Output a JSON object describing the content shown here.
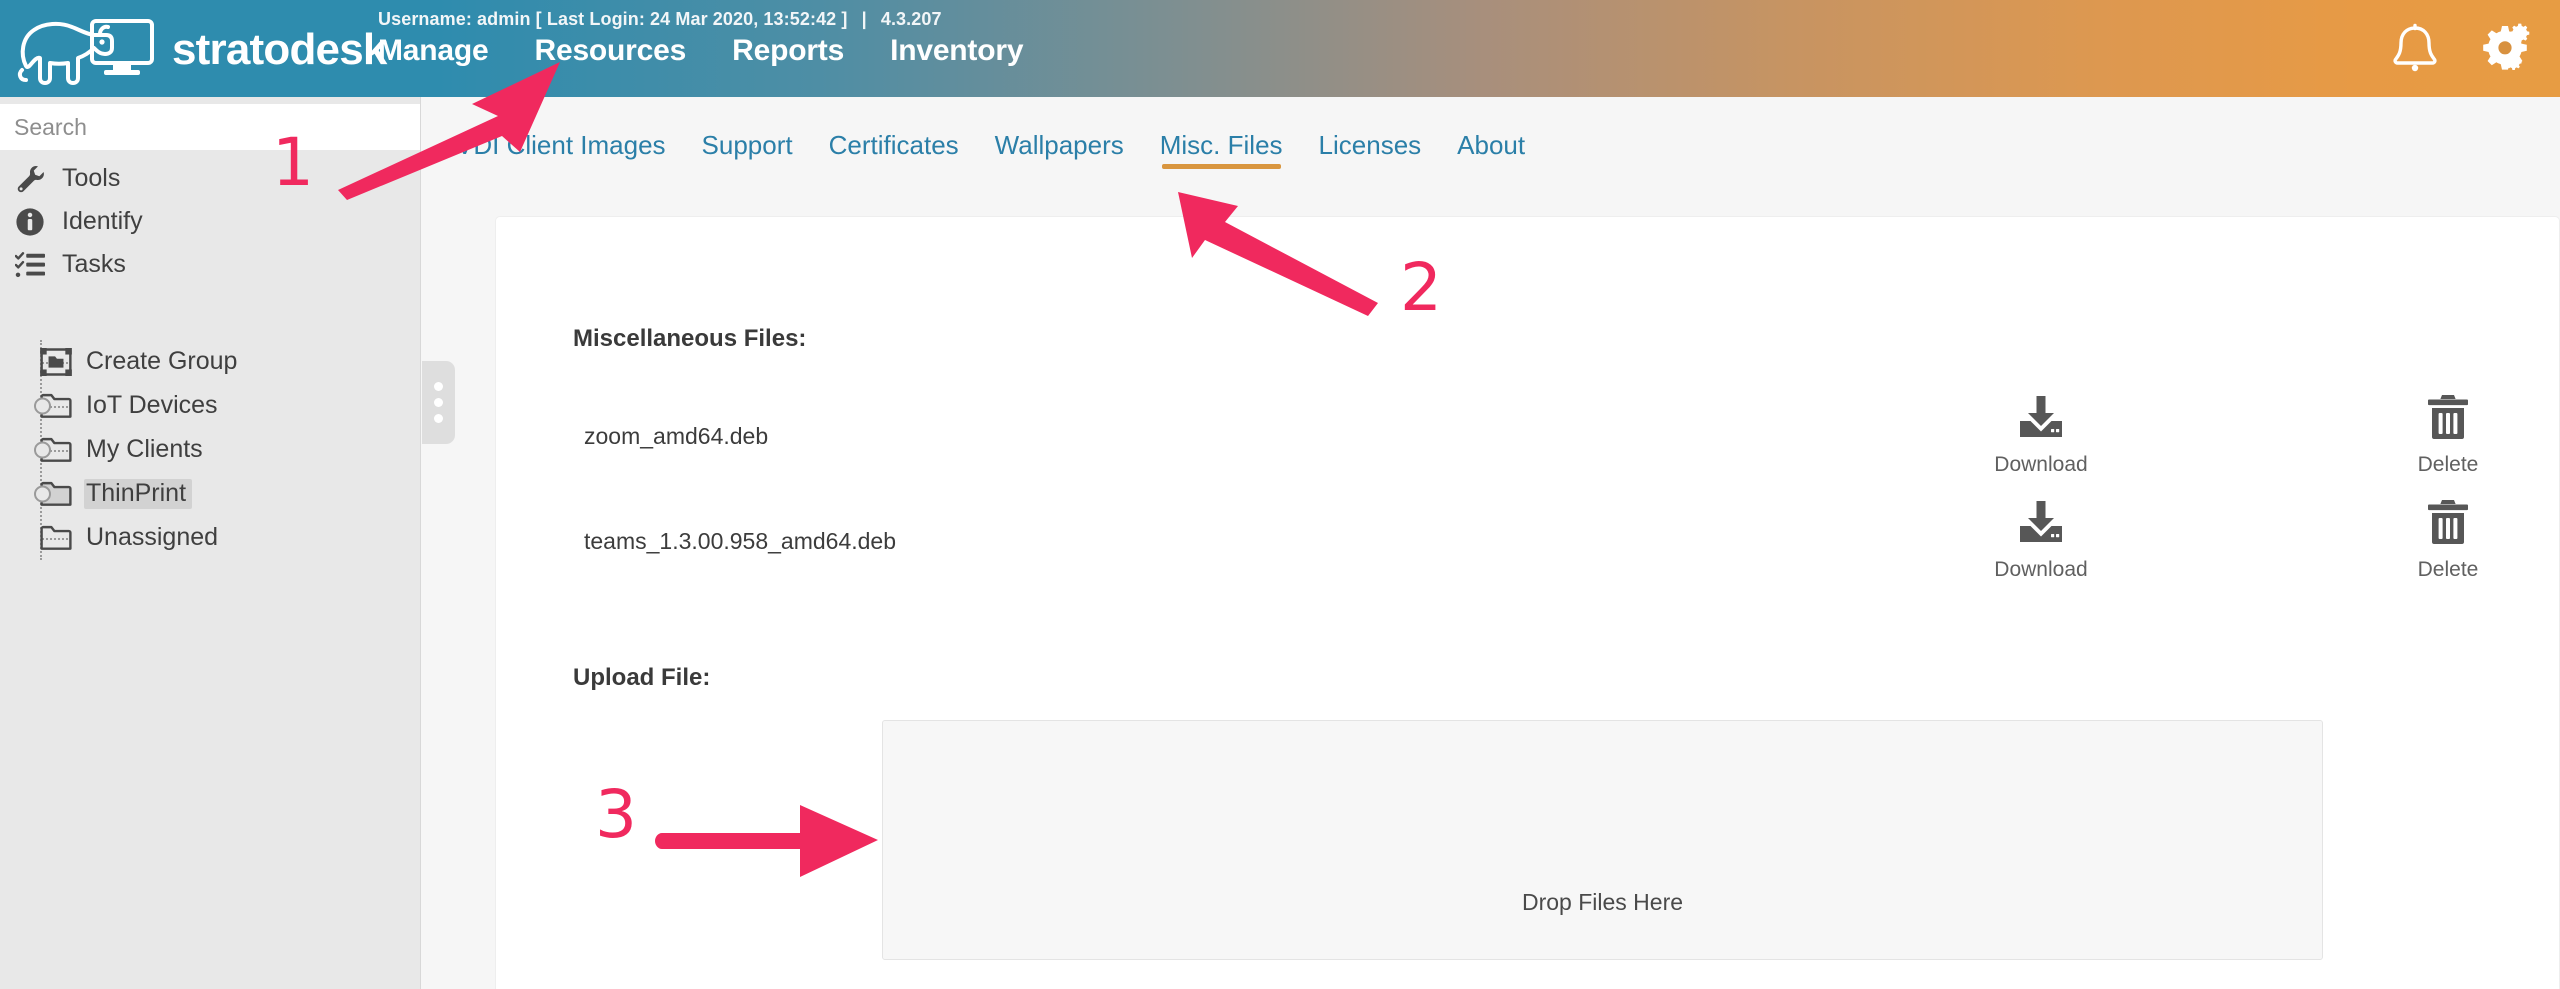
{
  "header": {
    "brand": "stratodesk",
    "logo_icon": "polar-bear-monitor-logo",
    "user_info": {
      "username_label": "Username: admin",
      "last_login_label": "[ Last Login: 24 Mar 2020, 13:52:42 ]",
      "separator": "|",
      "version": "4.3.207"
    },
    "nav": [
      {
        "label": "Manage",
        "name": "nav-manage"
      },
      {
        "label": "Resources",
        "name": "nav-resources"
      },
      {
        "label": "Reports",
        "name": "nav-reports"
      },
      {
        "label": "Inventory",
        "name": "nav-inventory"
      }
    ],
    "icons": [
      {
        "name": "bell-icon",
        "label": "Notifications"
      },
      {
        "name": "gears-icon",
        "label": "Settings"
      }
    ],
    "gradient_from": "#2e8cae",
    "gradient_to": "#e79c43"
  },
  "sidebar": {
    "search": {
      "placeholder": "Search",
      "value": ""
    },
    "items": [
      {
        "label": "Tools",
        "icon": "wrench-icon",
        "name": "sidebar-item-tools"
      },
      {
        "label": "Identify",
        "icon": "info-circle-icon",
        "name": "sidebar-item-identify"
      },
      {
        "label": "Tasks",
        "icon": "checklist-icon",
        "name": "sidebar-item-tasks"
      }
    ],
    "tree": [
      {
        "label": "Create Group",
        "icon": "create-group-icon",
        "selected": false
      },
      {
        "label": "IoT Devices",
        "icon": "folder-icon",
        "selected": false
      },
      {
        "label": "My Clients",
        "icon": "folder-icon",
        "selected": false
      },
      {
        "label": "ThinPrint",
        "icon": "folder-icon",
        "selected": true
      },
      {
        "label": "Unassigned",
        "icon": "folder-icon",
        "selected": false
      }
    ],
    "collapse_handle": "sidebar-collapse-handle",
    "background": "#e8e8e8"
  },
  "subnav": {
    "tabs": [
      {
        "label": "VDI Client Images",
        "active": false
      },
      {
        "label": "Support",
        "active": false
      },
      {
        "label": "Certificates",
        "active": false
      },
      {
        "label": "Wallpapers",
        "active": false
      },
      {
        "label": "Misc. Files",
        "active": true
      },
      {
        "label": "Licenses",
        "active": false
      },
      {
        "label": "About",
        "active": false
      }
    ],
    "link_color": "#2b7fa8",
    "active_underline_color": "#d9963f"
  },
  "main": {
    "misc_files_title": "Miscellaneous Files:",
    "upload_title": "Upload File:",
    "files": [
      {
        "name": "zoom_amd64.deb",
        "download_label": "Download",
        "download_icon": "download-icon",
        "delete_label": "Delete",
        "delete_icon": "trash-icon"
      },
      {
        "name": "teams_1.3.00.958_amd64.deb",
        "download_label": "Download",
        "download_icon": "download-icon",
        "delete_label": "Delete",
        "delete_icon": "trash-icon"
      }
    ],
    "dropzone": {
      "text": "Drop Files Here"
    }
  },
  "annotations": {
    "color": "#f0295e",
    "markers": [
      {
        "number": "1",
        "points_to": "nav-resources"
      },
      {
        "number": "2",
        "points_to": "tab-misc-files"
      },
      {
        "number": "3",
        "points_to": "dropzone"
      }
    ]
  }
}
